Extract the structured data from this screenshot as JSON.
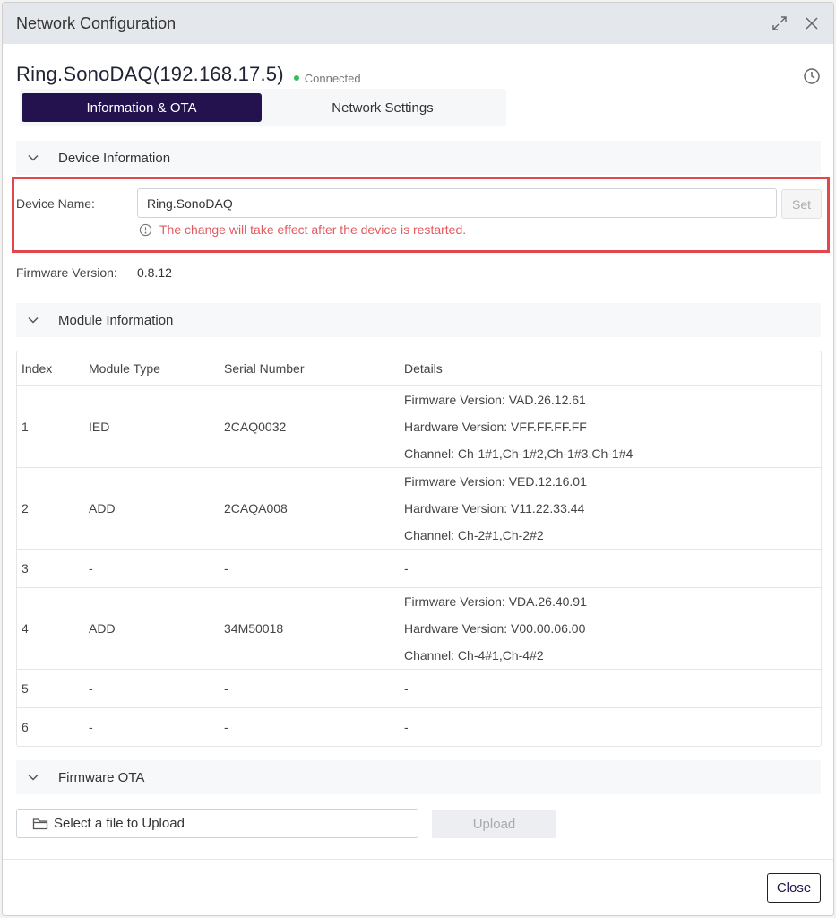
{
  "window": {
    "title": "Network Configuration"
  },
  "device": {
    "title": "Ring.SonoDAQ(192.168.17.5)",
    "status": "Connected",
    "status_color": "#2fbf5b"
  },
  "tabs": [
    {
      "label": "Information & OTA",
      "active": true
    },
    {
      "label": "Network Settings",
      "active": false
    }
  ],
  "sections": {
    "device_info": "Device Information",
    "module_info": "Module Information",
    "firmware_ota": "Firmware OTA"
  },
  "device_info": {
    "name_label": "Device Name:",
    "name_value": "Ring.SonoDAQ",
    "set_label": "Set",
    "warning": "The change will take effect after the device is restarted.",
    "firmware_label": "Firmware Version:",
    "firmware_value": "0.8.12"
  },
  "module_table": {
    "headers": [
      "Index",
      "Module Type",
      "Serial Number",
      "Details"
    ],
    "rows": [
      {
        "index": "1",
        "type": "IED",
        "serial": "2CAQ0032",
        "details": [
          "Firmware Version: VAD.26.12.61",
          "Hardware Version: VFF.FF.FF.FF",
          "Channel: Ch-1#1,Ch-1#2,Ch-1#3,Ch-1#4"
        ]
      },
      {
        "index": "2",
        "type": "ADD",
        "serial": "2CAQA008",
        "details": [
          "Firmware Version: VED.12.16.01",
          "Hardware Version: V11.22.33.44",
          "Channel: Ch-2#1,Ch-2#2"
        ]
      },
      {
        "index": "3",
        "type": "-",
        "serial": "-",
        "details": [
          "-"
        ]
      },
      {
        "index": "4",
        "type": "ADD",
        "serial": "34M50018",
        "details": [
          "Firmware Version: VDA.26.40.91",
          "Hardware Version: V00.00.06.00",
          "Channel: Ch-4#1,Ch-4#2"
        ]
      },
      {
        "index": "5",
        "type": "-",
        "serial": "-",
        "details": [
          "-"
        ]
      },
      {
        "index": "6",
        "type": "-",
        "serial": "-",
        "details": [
          "-"
        ]
      }
    ]
  },
  "ota": {
    "file_placeholder": "Select a file to Upload",
    "upload_label": "Upload"
  },
  "footer": {
    "close_label": "Close"
  },
  "icons": [
    "maximize-icon",
    "close-icon",
    "history-icon",
    "chevron-down-icon",
    "info-circle-icon",
    "folder-icon"
  ]
}
